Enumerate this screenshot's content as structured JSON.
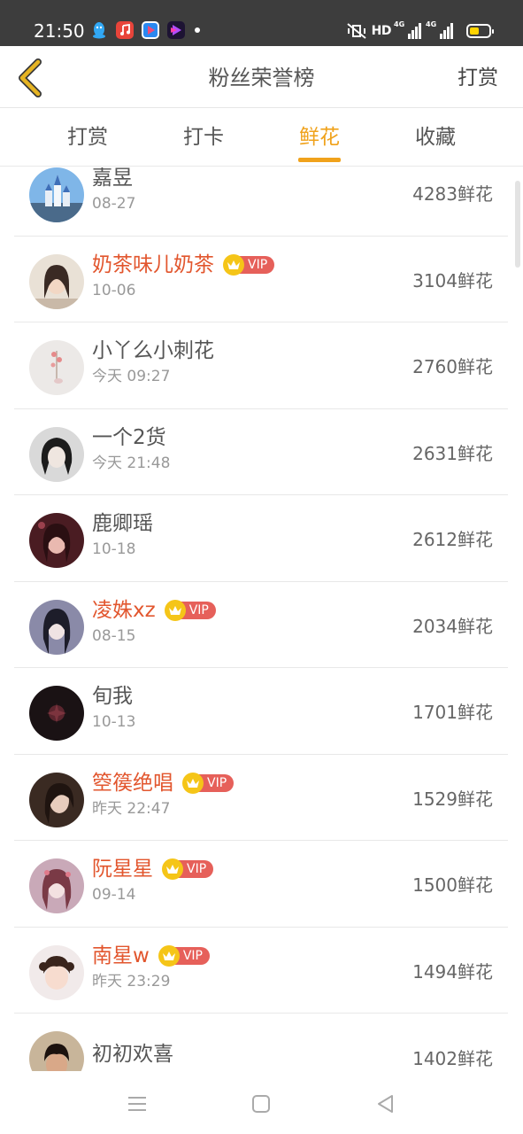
{
  "status_bar": {
    "time": "21:50",
    "network_label": "HD",
    "signal_labels": [
      "4G",
      "4G"
    ],
    "battery_color": "#ffd400",
    "app_icons": [
      "qq-icon",
      "music-icon",
      "video-app-icon",
      "player-app-icon"
    ]
  },
  "header": {
    "title": "粉丝荣誉榜",
    "action_label": "打赏",
    "back_icon_color": "#e6b422"
  },
  "tabs": [
    {
      "label": "打赏",
      "active": false
    },
    {
      "label": "打卡",
      "active": false
    },
    {
      "label": "鲜花",
      "active": true
    },
    {
      "label": "收藏",
      "active": false
    }
  ],
  "accent_color": "#f0a21b",
  "vip_name_color": "#e2562e",
  "vip_badge_label": "VIP",
  "fans": [
    {
      "name": "嘉昱",
      "date": "08-27",
      "count": "4283鲜花",
      "vip": false
    },
    {
      "name": "奶茶味儿奶茶",
      "date": "10-06",
      "count": "3104鲜花",
      "vip": true
    },
    {
      "name": "小丫么小刺花",
      "date": "今天 09:27",
      "count": "2760鲜花",
      "vip": false
    },
    {
      "name": "一个2货",
      "date": "今天 21:48",
      "count": "2631鲜花",
      "vip": false
    },
    {
      "name": "鹿卿瑶",
      "date": "10-18",
      "count": "2612鲜花",
      "vip": false
    },
    {
      "name": "凌姝xz",
      "date": "08-15",
      "count": "2034鲜花",
      "vip": true
    },
    {
      "name": "旬我",
      "date": "10-13",
      "count": "1701鲜花",
      "vip": false
    },
    {
      "name": "箜篌绝唱",
      "date": "昨天 22:47",
      "count": "1529鲜花",
      "vip": true
    },
    {
      "name": "阮星星",
      "date": "09-14",
      "count": "1500鲜花",
      "vip": true
    },
    {
      "name": "南星w",
      "date": "昨天 23:29",
      "count": "1494鲜花",
      "vip": true
    },
    {
      "name": "初初欢喜",
      "date": "",
      "count": "1402鲜花",
      "vip": false
    }
  ],
  "navbar": {
    "icons": [
      "menu-icon",
      "home-square-icon",
      "back-triangle-icon"
    ]
  }
}
